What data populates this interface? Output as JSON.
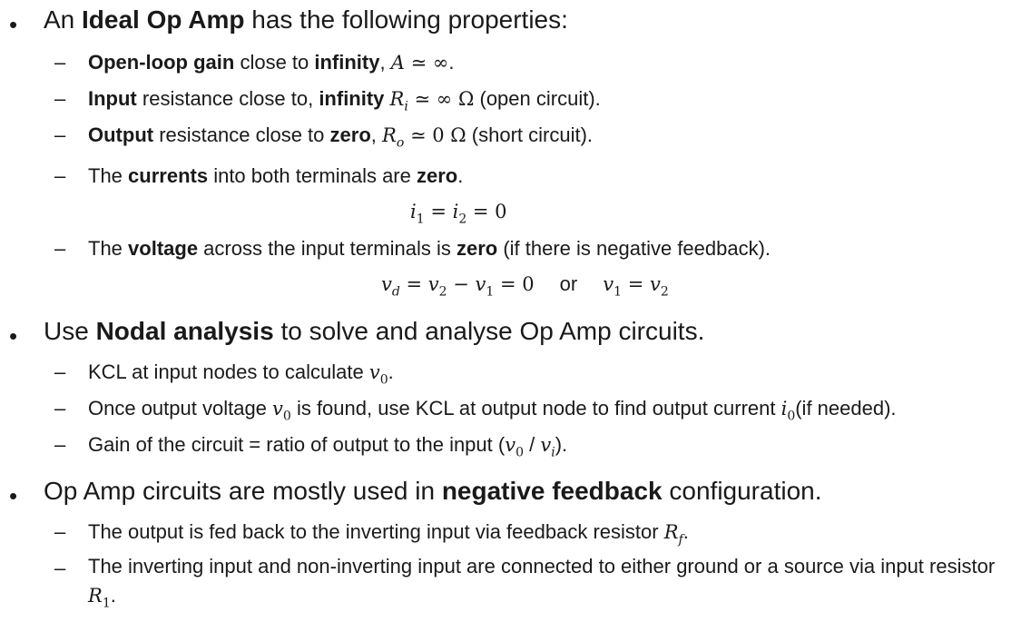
{
  "sec1": {
    "h_pre": "An ",
    "h_bold": "Ideal Op Amp",
    "h_post": " has the following properties:",
    "p1": {
      "b1": "Open-loop gain",
      "t1": " close to ",
      "b2": "infinity",
      "t2": ", ",
      "m1": "A",
      "m2": " ≃ ∞",
      "t3": "."
    },
    "p2": {
      "b1": "Input",
      "t1": " resistance close to, ",
      "b2": "infinity",
      "t2": " ",
      "m1": "R",
      "m1sub": "i",
      "m2": " ≃ ∞ Ω",
      "t3": " (open circuit)."
    },
    "p3": {
      "b1": "Output",
      "t1": " resistance close to ",
      "b2": "zero",
      "t2": ", ",
      "m1": "R",
      "m1sub": "o",
      "m2": " ≃ 0 Ω",
      "t3": " (short circuit)."
    },
    "p4": {
      "t1": "The ",
      "b1": "currents",
      "t2": " into both terminals are ",
      "b2": "zero",
      "t3": "."
    },
    "eq1": {
      "a": "i",
      "a_sub": "1",
      "b": " = ",
      "c": "i",
      "c_sub": "2",
      "d": " = 0"
    },
    "p5": {
      "t1": "The ",
      "b1": "voltage",
      "t2": " across the input terminals is ",
      "b2": "zero",
      "t3": " (if there is negative feedback)."
    },
    "eq2": {
      "a": "v",
      "a_sub": "d",
      "b": " = ",
      "c": "v",
      "c_sub": "2",
      "d": " − ",
      "e": "v",
      "e_sub": "1",
      "f": " = 0",
      "or": "or",
      "g": "v",
      "g_sub": "1",
      "h": " = ",
      "i": "v",
      "i_sub": "2"
    }
  },
  "sec2": {
    "h_pre": "Use ",
    "h_bold": "Nodal analysis",
    "h_post": " to solve and analyse Op Amp circuits.",
    "p1": {
      "t1": "KCL at input nodes to calculate ",
      "m1": "v",
      "m1sub": "0",
      "t2": "."
    },
    "p2": {
      "t1": "Once output voltage ",
      "m1": "v",
      "m1sub": "0",
      "t2": " is found, use KCL at output node to find output current ",
      "m2": "i",
      "m2sub": "0",
      "t3": "(if needed)."
    },
    "p3": {
      "t1": "Gain of the circuit = ratio of output to the input (",
      "m1": "v",
      "m1sub": "0",
      "t2": " / ",
      "m2": "v",
      "m2sub": "i",
      "t3": ")."
    }
  },
  "sec3": {
    "h_pre": "Op Amp circuits are mostly used in ",
    "h_bold": "negative feedback",
    "h_post": " configuration.",
    "p1": {
      "t1": "The output is fed back to the inverting input via feedback resistor ",
      "m1": "R",
      "m1sub": "f",
      "t2": "."
    },
    "p2": {
      "t1": "The inverting input and non-inverting input are connected to either ground or a source via input resistor ",
      "m1": "R",
      "m1sub": "1",
      "t2": "."
    }
  },
  "markers": {
    "bullet": "•",
    "dash": "–"
  }
}
